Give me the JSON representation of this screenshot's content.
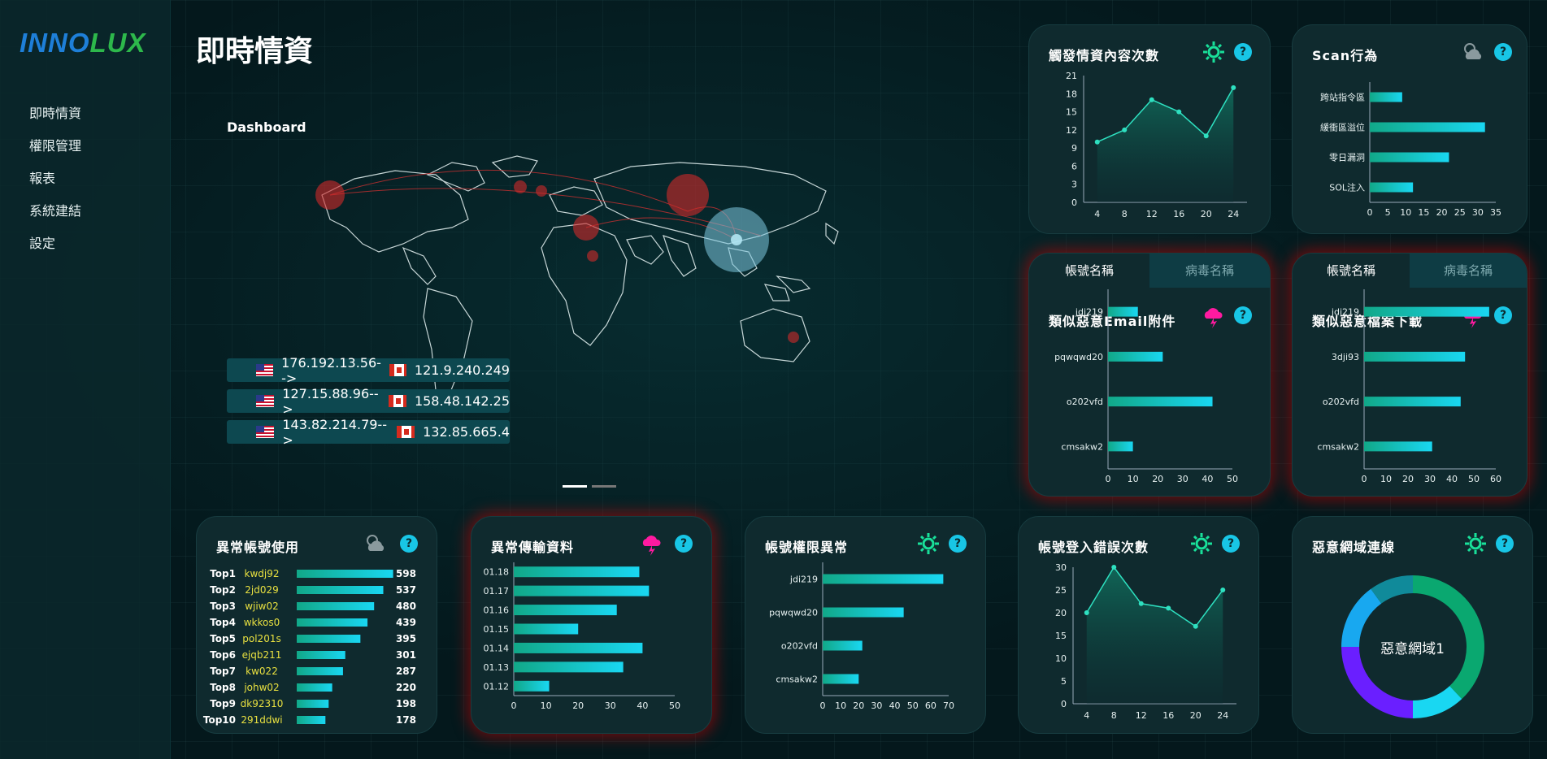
{
  "brand": {
    "logo_part1": "INNO",
    "logo_part2": "LUX"
  },
  "sidebar": {
    "items": [
      "即時情資",
      "權限管理",
      "報表",
      "系統建結",
      "設定"
    ]
  },
  "page_title": "即時情資",
  "dashboard_label": "Dashboard",
  "ip_list": [
    {
      "from": "176.192.13.56-->",
      "to": "121.9.240.249"
    },
    {
      "from": "127.15.88.96-->",
      "to": "158.48.142.25"
    },
    {
      "from": "143.82.214.79-->",
      "to": "132.85.665.4"
    }
  ],
  "colors": {
    "accent": "#18c6e6",
    "bar_start": "#11a888",
    "bar_end": "#19d7f2",
    "alert_glow": "#c80000",
    "donut": [
      "#0aa870",
      "#19d7f2",
      "#6a1fff",
      "#18a8f0",
      "#108a9a"
    ]
  },
  "cards": {
    "trigger": {
      "title": "觸發情資內容次數",
      "icon": "sun-icon",
      "help": "?"
    },
    "scan": {
      "title": "Scan行為",
      "icon": "cloudy-icon",
      "help": "?"
    },
    "email": {
      "tab_active": "帳號名稱",
      "tab_inactive": "病毒名稱",
      "title": "類似惡意Email附件",
      "icon": "storm-icon",
      "help": "?"
    },
    "download": {
      "tab_active": "帳號名稱",
      "tab_inactive": "病毒名稱",
      "title": "類似惡意檔案下載",
      "icon": "storm-icon",
      "help": "?"
    },
    "abnormal_account": {
      "title": "異常帳號使用",
      "icon": "cloudy-icon",
      "help": "?"
    },
    "abnormal_transfer": {
      "title": "異常傳輸資料",
      "icon": "storm-icon",
      "help": "?"
    },
    "permission": {
      "title": "帳號權限異常",
      "icon": "sun-icon",
      "help": "?"
    },
    "login_error": {
      "title": "帳號登入錯誤次數",
      "icon": "sun-icon",
      "help": "?"
    },
    "malicious_domain": {
      "title": "惡意網域連線",
      "icon": "sun-icon",
      "help": "?",
      "center_label": "惡意網域1"
    }
  },
  "chart_data": [
    {
      "id": "trigger",
      "type": "area",
      "x": [
        4,
        8,
        12,
        16,
        20,
        24
      ],
      "values": [
        10,
        12,
        17,
        15,
        11,
        19
      ],
      "xlim": [
        2,
        26
      ],
      "ylim": [
        0,
        21
      ],
      "yticks": [
        0,
        3,
        6,
        9,
        12,
        15,
        18,
        21
      ],
      "xticks": [
        4,
        8,
        12,
        16,
        20,
        24
      ]
    },
    {
      "id": "scan",
      "type": "bar",
      "orientation": "horizontal",
      "categories": [
        "跨站指令區",
        "緩衝區溢位",
        "零日漏洞",
        "SOL注入"
      ],
      "values": [
        9,
        32,
        22,
        12
      ],
      "xlim": [
        0,
        35
      ],
      "xticks": [
        0,
        5,
        10,
        15,
        20,
        25,
        30,
        35
      ]
    },
    {
      "id": "email",
      "type": "bar",
      "orientation": "horizontal",
      "categories": [
        "jdi219",
        "pqwqwd20",
        "o202vfd",
        "cmsakw2"
      ],
      "values": [
        12,
        22,
        42,
        10
      ],
      "xlim": [
        0,
        50
      ],
      "xticks": [
        0,
        10,
        20,
        30,
        40,
        50
      ]
    },
    {
      "id": "download",
      "type": "bar",
      "orientation": "horizontal",
      "categories": [
        "jdi219",
        "3dji93",
        "o202vfd",
        "cmsakw2"
      ],
      "values": [
        57,
        46,
        44,
        31
      ],
      "xlim": [
        0,
        60
      ],
      "xticks": [
        0,
        10,
        20,
        30,
        40,
        50,
        60
      ]
    },
    {
      "id": "abnormal_account",
      "type": "bar",
      "orientation": "horizontal",
      "ranks": [
        "Top1",
        "Top2",
        "Top3",
        "Top4",
        "Top5",
        "Top6",
        "Top7",
        "Top8",
        "Top9",
        "Top10"
      ],
      "categories": [
        "kwdj92",
        "2jd029",
        "wjiw02",
        "wkkos0",
        "pol201s",
        "ejqb211",
        "kw022",
        "johw02",
        "dk92310",
        "291ddwi"
      ],
      "values": [
        598,
        537,
        480,
        439,
        395,
        301,
        287,
        220,
        198,
        178
      ],
      "xlim": [
        0,
        600
      ]
    },
    {
      "id": "abnormal_transfer",
      "type": "bar",
      "orientation": "horizontal",
      "categories": [
        "01.18",
        "01.17",
        "01.16",
        "01.15",
        "01.14",
        "01.13",
        "01.12"
      ],
      "values": [
        39,
        42,
        32,
        20,
        40,
        34,
        11
      ],
      "xlim": [
        0,
        50
      ],
      "xticks": [
        0,
        10,
        20,
        30,
        40,
        50
      ]
    },
    {
      "id": "permission",
      "type": "bar",
      "orientation": "horizontal",
      "categories": [
        "jdi219",
        "pqwqwd20",
        "o202vfd",
        "cmsakw2"
      ],
      "values": [
        67,
        45,
        22,
        20
      ],
      "xlim": [
        0,
        70
      ],
      "xticks": [
        0,
        10,
        20,
        30,
        40,
        50,
        60,
        70
      ]
    },
    {
      "id": "login_error",
      "type": "area",
      "x": [
        4,
        8,
        12,
        16,
        20,
        24
      ],
      "values": [
        20,
        30,
        22,
        21,
        17,
        25
      ],
      "xlim": [
        2,
        26
      ],
      "ylim": [
        0,
        30
      ],
      "yticks": [
        0,
        5,
        10,
        15,
        20,
        25,
        30
      ],
      "xticks": [
        4,
        8,
        12,
        16,
        20,
        24
      ]
    },
    {
      "id": "malicious_domain",
      "type": "pie",
      "values": [
        38,
        12,
        25,
        15,
        10
      ]
    }
  ]
}
